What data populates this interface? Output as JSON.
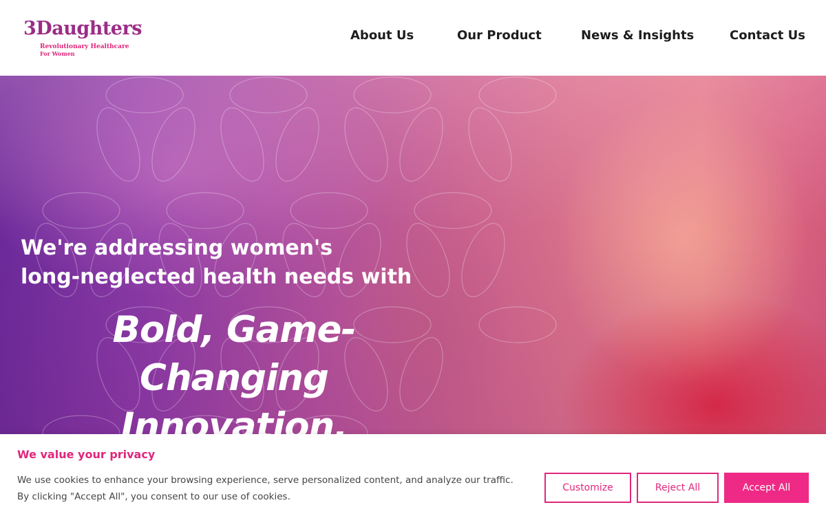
{
  "logo": {
    "name": "3Daughters",
    "tm": "™",
    "tagline_1": "Revolutionary Healthcare",
    "tagline_2": "For Women"
  },
  "nav": {
    "items": [
      {
        "label": "About Us"
      },
      {
        "label": "Our Product"
      },
      {
        "label": "News & Insights"
      },
      {
        "label": "Contact Us"
      }
    ]
  },
  "hero": {
    "line_1": "We're addressing women's",
    "line_2": "long-neglected health needs with",
    "headline_1": "Bold, Game-Changing",
    "headline_2": "Innovation."
  },
  "cookie": {
    "title": "We value your privacy",
    "text": "We use cookies to enhance your browsing experience, serve personalized content, and analyze our traffic. By clicking \"Accept All\", you consent to our use of cookies.",
    "customize_label": "Customize",
    "reject_label": "Reject All",
    "accept_label": "Accept All"
  },
  "colors": {
    "brand_purple": "#9b2d86",
    "brand_pink": "#e0267c",
    "accept_button": "#ee2a86"
  }
}
